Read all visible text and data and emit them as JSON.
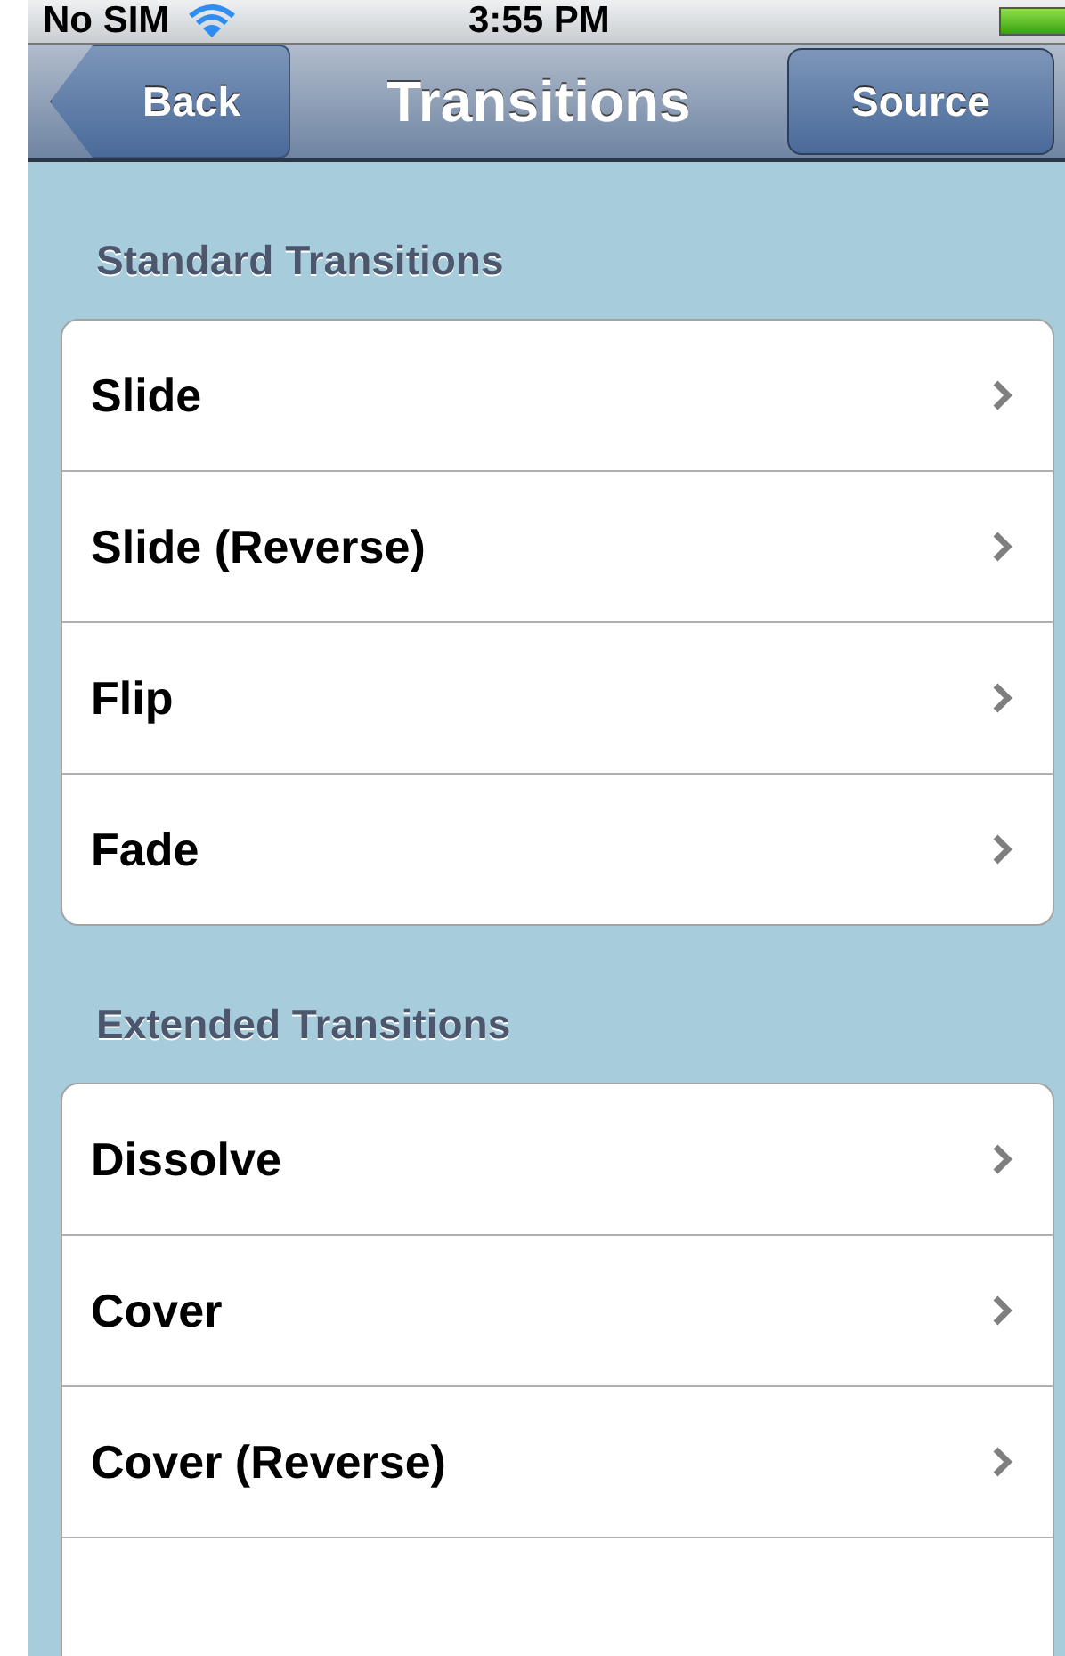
{
  "status_bar": {
    "carrier": "No SIM",
    "time": "3:55 PM"
  },
  "nav_bar": {
    "back": "Back",
    "title": "Transitions",
    "right_button": "Source"
  },
  "sections": [
    {
      "header": "Standard Transitions",
      "items": [
        {
          "label": "Slide"
        },
        {
          "label": "Slide (Reverse)"
        },
        {
          "label": "Flip"
        },
        {
          "label": "Fade"
        }
      ]
    },
    {
      "header": "Extended Transitions",
      "items": [
        {
          "label": "Dissolve"
        },
        {
          "label": "Cover"
        },
        {
          "label": "Cover (Reverse)"
        }
      ]
    }
  ]
}
